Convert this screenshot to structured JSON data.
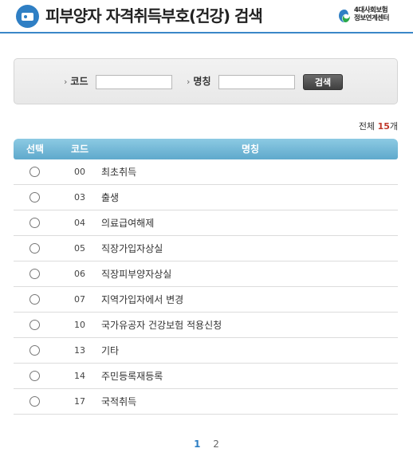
{
  "header": {
    "title": "피부양자 자격취득부호(건강) 검색",
    "logo_line1": "4대사회보험",
    "logo_line2": "정보연계센터"
  },
  "search": {
    "code_label": "코드",
    "name_label": "명칭",
    "code_value": "",
    "name_value": "",
    "button_label": "검색",
    "arrow": "›"
  },
  "summary": {
    "prefix": "전체 ",
    "count": "15",
    "suffix": "개"
  },
  "table": {
    "columns": [
      "선택",
      "코드",
      "명칭"
    ],
    "rows": [
      {
        "code": "00",
        "name": "최초취득"
      },
      {
        "code": "03",
        "name": "출생"
      },
      {
        "code": "04",
        "name": "의료급여해제"
      },
      {
        "code": "05",
        "name": "직장가입자상실"
      },
      {
        "code": "06",
        "name": "직장피부양자상실"
      },
      {
        "code": "07",
        "name": "지역가입자에서 변경"
      },
      {
        "code": "10",
        "name": "국가유공자 건강보험 적용신청"
      },
      {
        "code": "13",
        "name": "기타"
      },
      {
        "code": "14",
        "name": "주민등록재등록"
      },
      {
        "code": "17",
        "name": "국적취득"
      }
    ]
  },
  "pagination": {
    "pages": [
      "1",
      "2"
    ],
    "current": "1"
  },
  "colors": {
    "accent": "#2f7fc4",
    "table_header": "#6fb6d6",
    "count": "#c0392b"
  }
}
